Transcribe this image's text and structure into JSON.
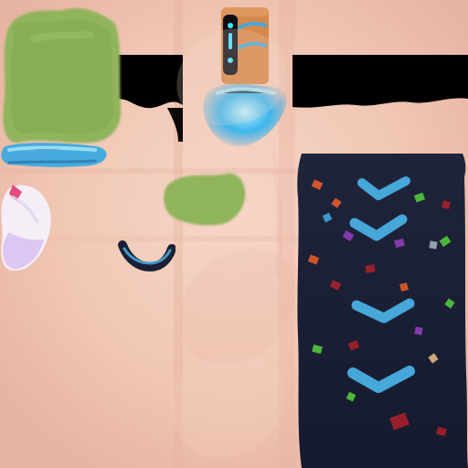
{
  "texture": {
    "kind": "character skin texture atlas",
    "palette": {
      "skin_base": "#f1c8b5",
      "skin_light": "#f6d6c7",
      "skin_shadow": "#e7b3a2",
      "black_band": "#000000",
      "green_patch": "#8fb45c",
      "green_dark": "#7ca245",
      "blue_glow": "#2aa6e6",
      "cyan_chevron": "#46a7d9",
      "navy_fabric": "#1b1f36",
      "orange_band": "#d5884b",
      "white_shell": "#f6eef7",
      "lavender_shell": "#d8c2f0",
      "pink_accent": "#e24b7e"
    },
    "confetti_colors": [
      "#3aa0d8",
      "#8a3bb2",
      "#d85a2a",
      "#a01f2c",
      "#50c03c",
      "#d7b27a"
    ]
  }
}
